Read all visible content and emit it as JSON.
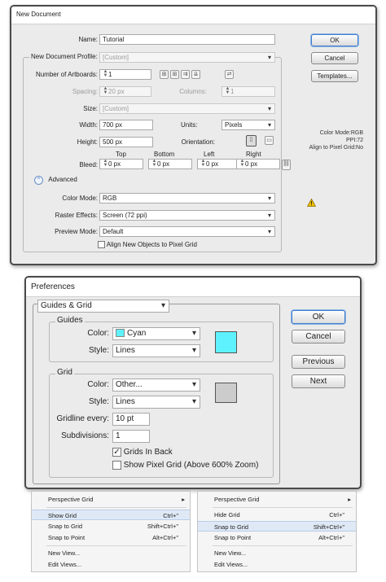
{
  "new_document": {
    "title": "New Document",
    "name_label": "Name:",
    "name_value": "Tutorial",
    "profile_label": "New Document Profile:",
    "profile_value": "[Custom]",
    "artboards_label": "Number of Artboards:",
    "artboards_value": "1",
    "spacing_label": "Spacing:",
    "spacing_value": "20 px",
    "columns_label": "Columns:",
    "columns_value": "1",
    "size_label": "Size:",
    "size_value": "[Custom]",
    "width_label": "Width:",
    "width_value": "700 px",
    "units_label": "Units:",
    "units_value": "Pixels",
    "height_label": "Height:",
    "height_value": "500 px",
    "orientation_label": "Orientation:",
    "bleed_label": "Bleed:",
    "bleed_top_label": "Top",
    "bleed_bottom_label": "Bottom",
    "bleed_left_label": "Left",
    "bleed_right_label": "Right",
    "bleed_top": "0 px",
    "bleed_bottom": "0 px",
    "bleed_left": "0 px",
    "bleed_right": "0 px",
    "advanced_label": "Advanced",
    "color_mode_label": "Color Mode:",
    "color_mode_value": "RGB",
    "raster_label": "Raster Effects:",
    "raster_value": "Screen (72 ppi)",
    "preview_label": "Preview Mode:",
    "preview_value": "Default",
    "align_label": "Align New Objects to Pixel Grid",
    "ok_label": "OK",
    "cancel_label": "Cancel",
    "templates_label": "Templates...",
    "info_line1": "Color Mode:RGB",
    "info_line2": "PPI:72",
    "info_line3": "Align to Pixel Grid:No"
  },
  "preferences": {
    "title": "Preferences",
    "section_value": "Guides & Grid",
    "guides_group": "Guides",
    "guides_color_label": "Color:",
    "guides_color_value": "Cyan",
    "guides_style_label": "Style:",
    "guides_style_value": "Lines",
    "grid_group": "Grid",
    "grid_color_label": "Color:",
    "grid_color_value": "Other...",
    "grid_style_label": "Style:",
    "grid_style_value": "Lines",
    "gridline_label": "Gridline every:",
    "gridline_value": "10 pt",
    "subdivisions_label": "Subdivisions:",
    "subdivisions_value": "1",
    "grids_in_back_label": "Grids In Back",
    "show_pixel_grid_label": "Show Pixel Grid (Above 600% Zoom)",
    "ok_label": "OK",
    "cancel_label": "Cancel",
    "previous_label": "Previous",
    "next_label": "Next",
    "guides_swatch_color": "#5ef2ff",
    "grid_swatch_color": "#cccccc"
  },
  "menus": {
    "left": {
      "perspective": "Perspective Grid",
      "show_grid": "Show Grid",
      "show_grid_sc": "Ctrl+\"",
      "snap_grid": "Snap to Grid",
      "snap_grid_sc": "Shift+Ctrl+\"",
      "snap_point": "Snap to Point",
      "snap_point_sc": "Alt+Ctrl+\"",
      "new_view": "New View...",
      "edit_views": "Edit Views..."
    },
    "right": {
      "perspective": "Perspective Grid",
      "hide_grid": "Hide Grid",
      "hide_grid_sc": "Ctrl+\"",
      "snap_grid": "Snap to Grid",
      "snap_grid_sc": "Shift+Ctrl+\"",
      "snap_point": "Snap to Point",
      "snap_point_sc": "Alt+Ctrl+\"",
      "new_view": "New View...",
      "edit_views": "Edit Views..."
    }
  }
}
